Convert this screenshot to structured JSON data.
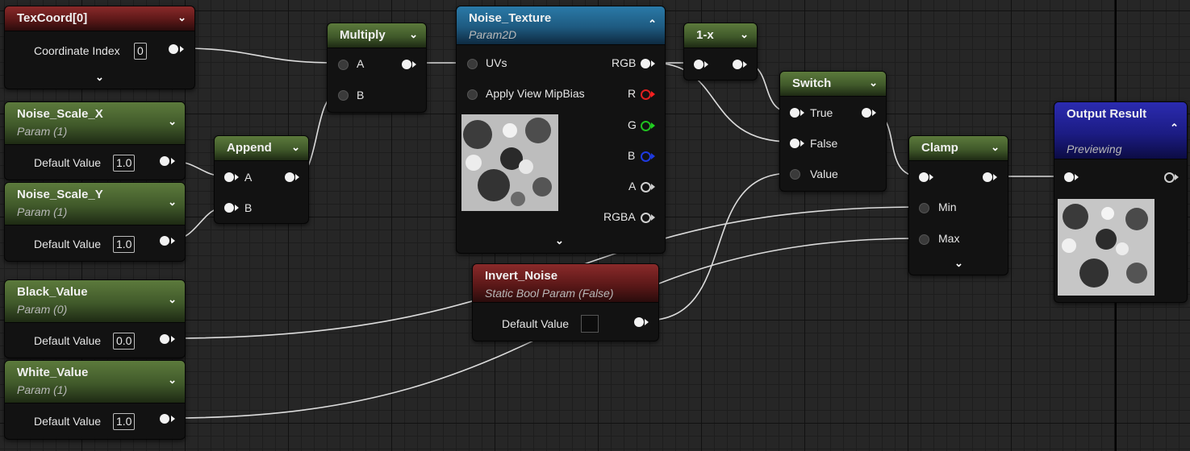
{
  "nodes": {
    "texcoord": {
      "title": "TexCoord[0]",
      "coordinate_label": "Coordinate Index",
      "coordinate_value": "0"
    },
    "noise_scale_x": {
      "title": "Noise_Scale_X",
      "subtitle": "Param (1)",
      "default_label": "Default Value",
      "default_value": "1.0"
    },
    "noise_scale_y": {
      "title": "Noise_Scale_Y",
      "subtitle": "Param (1)",
      "default_label": "Default Value",
      "default_value": "1.0"
    },
    "black_value": {
      "title": "Black_Value",
      "subtitle": "Param (0)",
      "default_label": "Default Value",
      "default_value": "0.0"
    },
    "white_value": {
      "title": "White_Value",
      "subtitle": "Param (1)",
      "default_label": "Default Value",
      "default_value": "1.0"
    },
    "append": {
      "title": "Append",
      "pin_a": "A",
      "pin_b": "B"
    },
    "multiply": {
      "title": "Multiply",
      "pin_a": "A",
      "pin_b": "B"
    },
    "noise_texture": {
      "title": "Noise_Texture",
      "subtitle": "Param2D",
      "in_uvs": "UVs",
      "in_mipbias": "Apply View MipBias",
      "out_rgb": "RGB",
      "out_r": "R",
      "out_g": "G",
      "out_b": "B",
      "out_a": "A",
      "out_rgba": "RGBA"
    },
    "one_minus_x": {
      "title": "1-x"
    },
    "switch": {
      "title": "Switch",
      "pin_true": "True",
      "pin_false": "False",
      "pin_value": "Value"
    },
    "invert_noise": {
      "title": "Invert_Noise",
      "subtitle": "Static Bool Param (False)",
      "default_label": "Default Value"
    },
    "clamp": {
      "title": "Clamp",
      "pin_min": "Min",
      "pin_max": "Max"
    },
    "output": {
      "title": "Output Result",
      "subtitle": "Previewing"
    }
  },
  "icons": {
    "collapse": "chevron-down-icon",
    "expand_up": "chevron-up-icon"
  },
  "colors": {
    "param_header": "#4a6630",
    "texcoord_header": "#6b1e1e",
    "texture_header": "#1e6a96",
    "output_header": "#1f1f90",
    "static_bool_header": "#6b1e1e"
  }
}
